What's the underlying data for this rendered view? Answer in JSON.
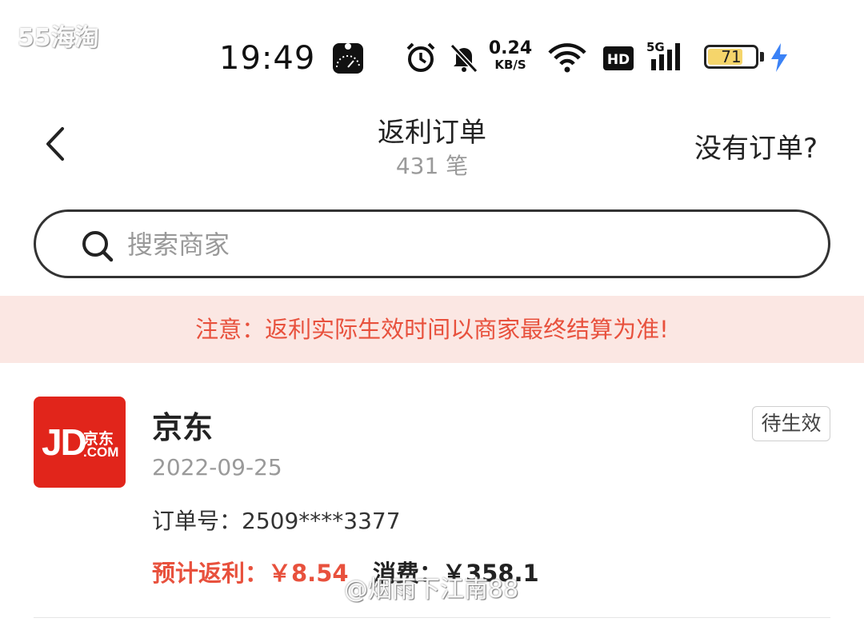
{
  "watermark_top": "55海淘",
  "status_bar": {
    "time": "19:49",
    "net_speed_value": "0.24",
    "net_speed_unit": "KB/S",
    "hd_label": "HD",
    "network_label": "5G",
    "battery_level": "71"
  },
  "header": {
    "title": "返利订单",
    "subtitle": "431 笔",
    "help_link": "没有订单?"
  },
  "search": {
    "placeholder": "搜索商家"
  },
  "notice": {
    "text": "注意：返利实际生效时间以商家最终结算为准!"
  },
  "orders": [
    {
      "logo_text": "JD",
      "logo_cn": "京东",
      "logo_com": ".COM",
      "merchant": "京东",
      "status": "待生效",
      "date": "2022-09-25",
      "order_number": "订单号：2509****3377",
      "cashback": "预计返利：￥8.54",
      "spend": "消费：￥358.1"
    }
  ],
  "watermark_bottom": "@烟雨下江南88",
  "colors": {
    "accent": "#e8513d",
    "notice_bg": "#fbe7e3",
    "jd_red": "#e1251b"
  }
}
